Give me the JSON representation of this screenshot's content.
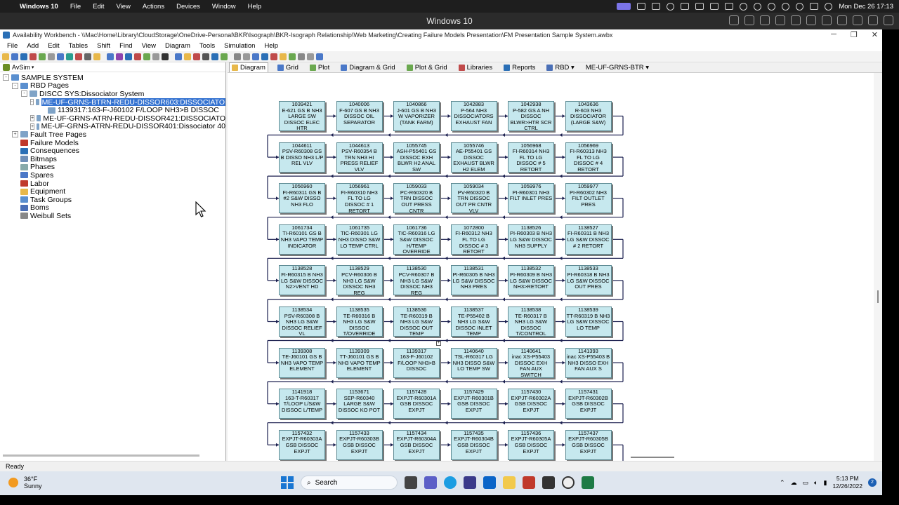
{
  "mac_bar": {
    "apple_icon": "apple-icon",
    "app_name": "Windows 10",
    "menus": [
      "File",
      "Edit",
      "View",
      "Actions",
      "Devices",
      "Window",
      "Help"
    ],
    "datetime": "Mon Dec 26  17:13"
  },
  "vm_bar": {
    "title": "Windows 10"
  },
  "window": {
    "title": "Availability Workbench - \\\\Mac\\Home\\Library\\CloudStorage\\OneDrive-Personal\\BKR\\Isograph\\BKR-Isograph Relationship\\Web Marketing\\Creating Failure Models Presentation\\FM Presentation Sample System.awbx",
    "menus": [
      "File",
      "Add",
      "Edit",
      "Tables",
      "Shift",
      "Find",
      "View",
      "Diagram",
      "Tools",
      "Simulation",
      "Help"
    ],
    "avsim_label": "AvSim"
  },
  "tree": [
    {
      "label": "SAMPLE SYSTEM",
      "indent": 0,
      "expander": "-",
      "icon": "system-icon",
      "selected": false
    },
    {
      "label": "RBD Pages",
      "indent": 1,
      "expander": "-",
      "icon": "rbd-pages-icon",
      "selected": false
    },
    {
      "label": "DISCC SYS:Dissociator System",
      "indent": 2,
      "expander": "-",
      "icon": "page-icon",
      "selected": false
    },
    {
      "label": "ME-UF-GRNS-BTRN-REDU-DISSOR603:DISSOCIATO",
      "indent": 3,
      "expander": "-",
      "icon": "page-icon",
      "selected": true
    },
    {
      "label": "1139317:163-F-J60102 F/LOOP NH3>B DISSOC",
      "indent": 4,
      "expander": "",
      "icon": "page-icon",
      "selected": false
    },
    {
      "label": "ME-UF-GRNS-ATRN-REDU-DISSOR421:DISSOCIATO",
      "indent": 3,
      "expander": "+",
      "icon": "page-icon",
      "selected": false
    },
    {
      "label": "ME-UF-GRNS-ATRN-REDU-DISSOR401:Dissociator 40",
      "indent": 3,
      "expander": "+",
      "icon": "page-icon",
      "selected": false
    },
    {
      "label": "Fault Tree Pages",
      "indent": 1,
      "expander": "+",
      "icon": "fault-tree-icon",
      "selected": false
    },
    {
      "label": "Failure Models",
      "indent": 1,
      "expander": "",
      "icon": "failure-models-icon",
      "selected": false
    },
    {
      "label": "Consequences",
      "indent": 1,
      "expander": "",
      "icon": "consequences-icon",
      "selected": false
    },
    {
      "label": "Bitmaps",
      "indent": 1,
      "expander": "",
      "icon": "bitmaps-icon",
      "selected": false
    },
    {
      "label": "Phases",
      "indent": 1,
      "expander": "",
      "icon": "phases-icon",
      "selected": false
    },
    {
      "label": "Spares",
      "indent": 1,
      "expander": "",
      "icon": "spares-icon",
      "selected": false
    },
    {
      "label": "Labor",
      "indent": 1,
      "expander": "",
      "icon": "labor-icon",
      "selected": false
    },
    {
      "label": "Equipment",
      "indent": 1,
      "expander": "",
      "icon": "equipment-icon",
      "selected": false
    },
    {
      "label": "Task Groups",
      "indent": 1,
      "expander": "",
      "icon": "task-groups-icon",
      "selected": false
    },
    {
      "label": "Boms",
      "indent": 1,
      "expander": "",
      "icon": "boms-icon",
      "selected": false
    },
    {
      "label": "Weibull Sets",
      "indent": 1,
      "expander": "",
      "icon": "weibull-sets-icon",
      "selected": false
    }
  ],
  "tabs": [
    {
      "label": "Diagram",
      "active": true,
      "icon": "diagram-icon"
    },
    {
      "label": "Grid",
      "active": false,
      "icon": "grid-icon"
    },
    {
      "label": "Plot",
      "active": false,
      "icon": "plot-icon"
    },
    {
      "label": "Diagram & Grid",
      "active": false,
      "icon": "diagram-grid-icon"
    },
    {
      "label": "Plot & Grid",
      "active": false,
      "icon": "plot-grid-icon"
    },
    {
      "label": "Libraries",
      "active": false,
      "icon": "libraries-icon"
    },
    {
      "label": "Reports",
      "active": false,
      "icon": "reports-icon"
    },
    {
      "label": "RBD ▾",
      "active": false,
      "icon": "rbd-icon"
    },
    {
      "label": "ME-UF-GRNS-BTR ▾",
      "active": false,
      "icon": ""
    }
  ],
  "blocks": [
    [
      {
        "id": "1039421",
        "desc": "E-621 GS B NH3 LARGE SW DISSOC ELEC HTR"
      },
      {
        "id": "1040006",
        "desc": "F-607 GS B NH3 DISSOC OIL SEPARATOR"
      },
      {
        "id": "1040866",
        "desc": "J-601 GS B NH3 W VAPORIZER (TANK FARM)"
      },
      {
        "id": "1042883",
        "desc": "P-564 NH3 DISSOCIATORS EXHAUST FAN"
      },
      {
        "id": "1042938",
        "desc": "P-582 GS A NH DISSOC BLWR>HTR SCR CTRL"
      },
      {
        "id": "1043636",
        "desc": "R-603 NH3 DISSOCIATOR (LARGE S&W)"
      }
    ],
    [
      {
        "id": "1044611",
        "desc": "PSV-R60308 GS B DISSO NH3 L/P REL VLV"
      },
      {
        "id": "1044613",
        "desc": "PSV-R60354 B TRN NH3 HI PRESS RELIEF VLV"
      },
      {
        "id": "1055745",
        "desc": "ASH-P55401 GS DISSOC EXH BLWR H2 ANAL SW"
      },
      {
        "id": "1055746",
        "desc": "AE-P55401 GS DISSOC EXHAUST BLWR H2 ELEM"
      },
      {
        "id": "1056968",
        "desc": "FI-R60314 NH3 FL TO LG DISSOC # 5 RETORT"
      },
      {
        "id": "1056969",
        "desc": "FI-R60313 NH3 FL TO LG DISSOC # 4 RETORT"
      }
    ],
    [
      {
        "id": "1056960",
        "desc": "FI-R60311 GS B #2 S&W DISSO NH3 FLO"
      },
      {
        "id": "1056961",
        "desc": "FI-R60310 NH3 FL TO LG DISSOC # 1 RETORT"
      },
      {
        "id": "1059033",
        "desc": "PC-R60320 B TRN DISSOC OUT PRESS CNTR"
      },
      {
        "id": "1059034",
        "desc": "PV-R60320 B TRN DISSOC OUT PR CNTR VLV"
      },
      {
        "id": "1059976",
        "desc": "PI-R60301 NH3 FILT INLET PRES"
      },
      {
        "id": "1059977",
        "desc": "PI-R60302 NH3 FILT OUTLET PRES"
      }
    ],
    [
      {
        "id": "1061734",
        "desc": "TI-R60101 GS B NH3 VAPO TEMP INDICATOR"
      },
      {
        "id": "1061735",
        "desc": "TIC-R60301 LG NH3 DISSO S&W LO TEMP CTRL"
      },
      {
        "id": "1061736",
        "desc": "TIC-R60316 LG S&W DISSOC H/TEMP OVERRIDE"
      },
      {
        "id": "1072800",
        "desc": "FI-R60312 NH3 FL TO LG DISSOC # 3 RETORT"
      },
      {
        "id": "1138526",
        "desc": "PI-R60303 B NH3 LG S&W DISSOC NH3 SUPPLY"
      },
      {
        "id": "1138527",
        "desc": "FI-R60311 B NH3 LG S&W DISSOC # 2 RETORT"
      }
    ],
    [
      {
        "id": "1138528",
        "desc": "FI-R60315 B NH3 LG S&W DISSOC N2>VENT HD"
      },
      {
        "id": "1138529",
        "desc": "PCV-R60306 B NH3 LG S&W DISSOC NH3 REG"
      },
      {
        "id": "1138530",
        "desc": "PCV-R60307 B NH3 LG S&W DISSOC NH3 REG"
      },
      {
        "id": "1138531",
        "desc": "PI-R60305 B NH3 LG S&W DISSOC NH3 PRES"
      },
      {
        "id": "1138532",
        "desc": "PI-R60309 B NH3 LG S&W DISSOC NH3>RETORT"
      },
      {
        "id": "1138533",
        "desc": "PI-R60318 B NH3 LG S&W DISSOC OUT PRES"
      }
    ],
    [
      {
        "id": "1138534",
        "desc": "PSV-R60308 B NH3 LG S&W DISSOC RELIEF VL"
      },
      {
        "id": "1138535",
        "desc": "TE-R60316 B NH3 LG S&W DISSOC T/OVERRIDE"
      },
      {
        "id": "1138536",
        "desc": "TE-R60319 B NH3 LG S&W DISSOC OUT TEMP"
      },
      {
        "id": "1138537",
        "desc": "TE-P55402 B NH3 LG S&W DISSOC INLET TEMP"
      },
      {
        "id": "1138538",
        "desc": "TE-R60317 B NH3 LG S&W DISSOC T/CONTROL"
      },
      {
        "id": "1138539",
        "desc": "TT-R60319 B NH3 LG S&W DISSOC LO TEMP"
      }
    ],
    [
      {
        "id": "1139308",
        "desc": "TE-J60101 GS B NH3 VAPO TEMP ELEMENT"
      },
      {
        "id": "1139309",
        "desc": "TT-J60101 GS B NH3 VAPO TEMP ELEMENT"
      },
      {
        "id": "1139317",
        "desc": "163-F-J60102 F/LOOP NH3>B DISSOC"
      },
      {
        "id": "1140640",
        "desc": "TSL-R60317 LG NH3 DISSO S&W LO TEMP SW"
      },
      {
        "id": "1140641",
        "desc": "inac XS-P55403 DISSOC EXH FAN AUX SWITCH"
      },
      {
        "id": "1141393",
        "desc": "inac XS-P55403 B NH3 DISSO EXH FAN AUX S"
      }
    ],
    [
      {
        "id": "1141918",
        "desc": "163-T-R60317 T/LOOP L/S&W DISSOC L/TEMP"
      },
      {
        "id": "1153671",
        "desc": "SEP-R60340 LARGE S&W DISSOC KO POT"
      },
      {
        "id": "1157428",
        "desc": "EXPJT-R60301A GSB DISSOC EXPJT"
      },
      {
        "id": "1157429",
        "desc": "EXPJT-R60301B GSB DISSOC EXPJT"
      },
      {
        "id": "1157430",
        "desc": "EXPJT-R60302A GSB DISSOC EXPJT"
      },
      {
        "id": "1157431",
        "desc": "EXPJT-R60302B GSB DISSOC EXPJT"
      }
    ],
    [
      {
        "id": "1157432",
        "desc": "EXPJT-R60303A GSB DISSOC EXPJT"
      },
      {
        "id": "1157433",
        "desc": "EXPJT-R60303B GSB DISSOC EXPJT"
      },
      {
        "id": "1157434",
        "desc": "EXPJT-R60304A GSB DISSOC EXPJT"
      },
      {
        "id": "1157435",
        "desc": "EXPJT-R60304B GSB DISSOC EXPJT"
      },
      {
        "id": "1157436",
        "desc": "EXPJT-R60305A GSB DISSOC EXPJT"
      },
      {
        "id": "1157437",
        "desc": "EXPJT-R60305B GSB DISSOC EXPJT"
      }
    ]
  ],
  "status": {
    "text": "Ready"
  },
  "taskbar": {
    "weather_temp": "36°F",
    "weather_desc": "Sunny",
    "search_label": "Search",
    "time": "5:13 PM",
    "date": "12/26/2022",
    "notification_count": "2"
  }
}
